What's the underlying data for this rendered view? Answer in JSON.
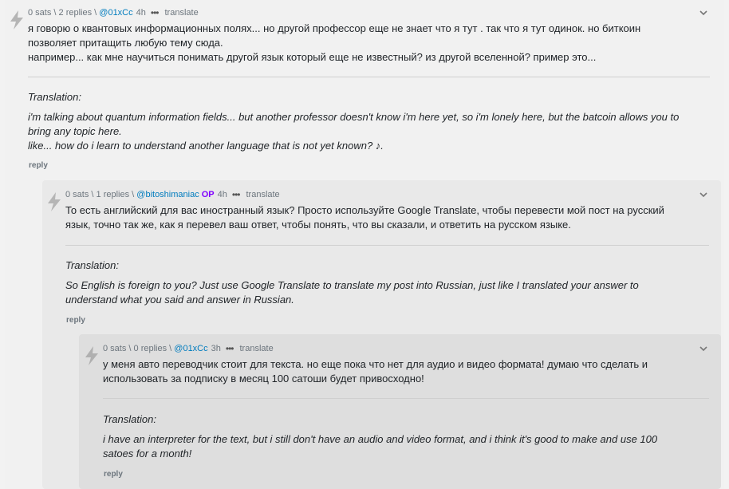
{
  "comments": [
    {
      "meta": {
        "sats": "0 sats",
        "replies": "2 replies",
        "user": "@01xCc",
        "op": "",
        "time": "4h",
        "translate": "translate"
      },
      "body": [
        "я говорю о квантовых информационных полях... но другой профессор еще не знает что я тут . так что я тут одинок. но биткоин",
        "позволяет притащить любую тему сюда.",
        "например... как мне научиться понимать другой язык который еще не известный? из другой вселенной? пример это..."
      ],
      "translation_label": "Translation:",
      "translation": [
        "i'm talking about quantum information fields... but another professor doesn't know i'm here yet, so i'm lonely here, but the batcoin allows you to",
        "bring any topic here.",
        "like... how do i learn to understand another language that is not yet known? ♪."
      ],
      "reply": "reply"
    },
    {
      "meta": {
        "sats": "0 sats",
        "replies": "1 replies",
        "user": "@bitoshimaniac",
        "op": "OP",
        "time": "4h",
        "translate": "translate"
      },
      "body": [
        "То есть английский для вас иностранный язык? Просто используйте Google Translate, чтобы перевести мой пост на русский",
        "язык, точно так же, как я перевел ваш ответ, чтобы понять, что вы сказали, и ответить на русском языке."
      ],
      "translation_label": "Translation:",
      "translation": [
        "So English is foreign to you? Just use Google Translate to translate my post into Russian, just like I translated your answer to",
        "understand what you said and answer in Russian."
      ],
      "reply": "reply"
    },
    {
      "meta": {
        "sats": "0 sats",
        "replies": "0 replies",
        "user": "@01xCc",
        "op": "",
        "time": "3h",
        "translate": "translate"
      },
      "body": [
        "у меня авто переводчик стоит для текста. но еще пока что нет для аудио и видео формата! думаю что сделать и",
        "использовать за подписку в месяц 100 сатоши будет привосходно!"
      ],
      "translation_label": "Translation:",
      "translation": [
        "i have an interpreter for the text, but i still don't have an audio and video format, and i think it's good to make and use 100",
        "satoes for a month!"
      ],
      "reply": "reply"
    }
  ],
  "icons": {
    "zap": "lightning-bolt-icon",
    "more": "more-dots-icon",
    "collapse": "collapse-chevron-icon"
  },
  "colors": {
    "user": "#007cbe",
    "op": "#8000ff",
    "meta": "#6c757d"
  },
  "sep": " \\ "
}
